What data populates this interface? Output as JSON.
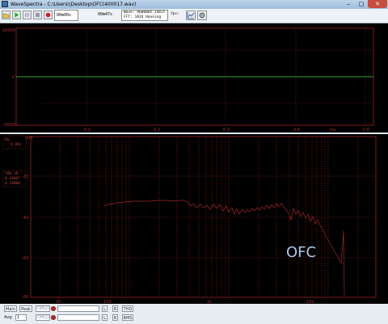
{
  "window": {
    "title": "WaveSpectra - C:\\Users\\\\Desktop\\OFC(400017.wav)",
    "minimize_glyph": "–",
    "maximize_glyph": "□",
    "close_glyph": "✕"
  },
  "toolbar": {
    "time_display": "00m00s",
    "duration_display": "00m47s",
    "wave_info": "Wave: 96000Hz 24bit 2ch",
    "fft_info": "FFT: 1024 Hanning",
    "fps_label": "fps:"
  },
  "waveform": {
    "y_max_label": "16000",
    "y_zero_label": "0",
    "y_min_label": "-16000",
    "x_ticks": [
      "0.1",
      "0.2",
      "0.3",
      "0.4",
      "0.5"
    ],
    "x_unit": "ms",
    "trace_color": "#2fa83a"
  },
  "spectrum": {
    "db_unit": "0dB",
    "cursor_box_lines": [
      "No.",
      "0.0Hz"
    ],
    "thd_box_lines": [
      "THD.+N",
      "0.26807",
      "0.24000"
    ],
    "y_ticks": [
      "-20",
      "-40",
      "-60",
      "-80"
    ],
    "x_tick_labels": [
      "20",
      "100",
      "1k",
      "10k"
    ],
    "annotation": "OFC",
    "trace_color": "#a02828",
    "grid_color": "#8a1f1f"
  },
  "bottom_bar": {
    "main_label": "Main",
    "peak_label": "Peak",
    "avg_label": "Avg:",
    "avg_value": "1",
    "omlo_label": "OMLO",
    "l_label": "L",
    "r_label": "R",
    "thd_button": "THD",
    "rms_button": "RMS"
  }
}
